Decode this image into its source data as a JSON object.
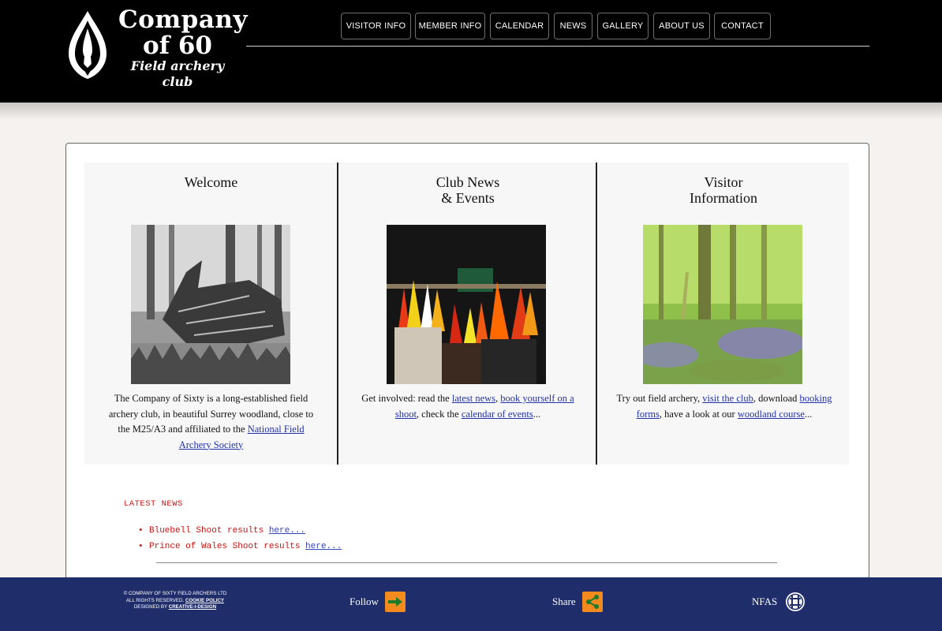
{
  "site": {
    "logo_line1": "Company",
    "logo_line2": "of 60",
    "logo_line3": "Field archery club"
  },
  "nav": {
    "items": [
      {
        "label": "VISITOR INFO"
      },
      {
        "label": "MEMBER INFO"
      },
      {
        "label": "CALENDAR"
      },
      {
        "label": "NEWS"
      },
      {
        "label": "GALLERY"
      },
      {
        "label": "ABOUT US"
      },
      {
        "label": "CONTACT"
      }
    ]
  },
  "columns": [
    {
      "title_1": "Welcome",
      "title_2": "",
      "image": "woodland-log-bw",
      "text_before": "The Company of Sixty is a long-established field archery club, in beautiful Surrey woodland, close to the M25/A3 and affiliated to the ",
      "link_1": "National Field Archery Society"
    },
    {
      "title_1": "Club News",
      "title_2": "& Events",
      "image": "arrow-quivers",
      "text_before": "Get involved: read the ",
      "link_1": "latest news",
      "sep_1": ", ",
      "link_2": "book yourself on a shoot",
      "sep_2": ", check the ",
      "link_3": "calendar of events",
      "text_after": "..."
    },
    {
      "title_1": "Visitor",
      "title_2": "Information",
      "image": "bluebell-wood",
      "text_before": "Try out field archery, ",
      "link_1": "visit the club",
      "sep_1": ", download ",
      "link_2": "booking forms",
      "sep_2": ", have a look at our ",
      "link_3": "woodland course",
      "text_after": "..."
    }
  ],
  "latest_news": {
    "heading": "LATEST NEWS",
    "items": [
      {
        "text": "Bluebell Shoot results ",
        "link": "here..."
      },
      {
        "text": "Prince of Wales Shoot results ",
        "link": "here..."
      }
    ]
  },
  "footer": {
    "copy_1": "© COMPANY OF SIXTY FIELD ARCHERS LTD",
    "copy_2": "ALL RIGHTS RESERVED. ",
    "cookie_link": "COOKIE POLICY",
    "copy_3": "DESIGNED BY ",
    "designer_link": "CREATIVE-I-DESIGN",
    "follow_label": "Follow",
    "follow_icon": "arrow-right-icon",
    "share_label": "Share",
    "share_icon": "share-icon",
    "nfas_label": "NFAS",
    "nfas_icon": "nfas-logo-icon",
    "accent_color": "#f28a1e",
    "footer_color": "#1f2d6b"
  }
}
